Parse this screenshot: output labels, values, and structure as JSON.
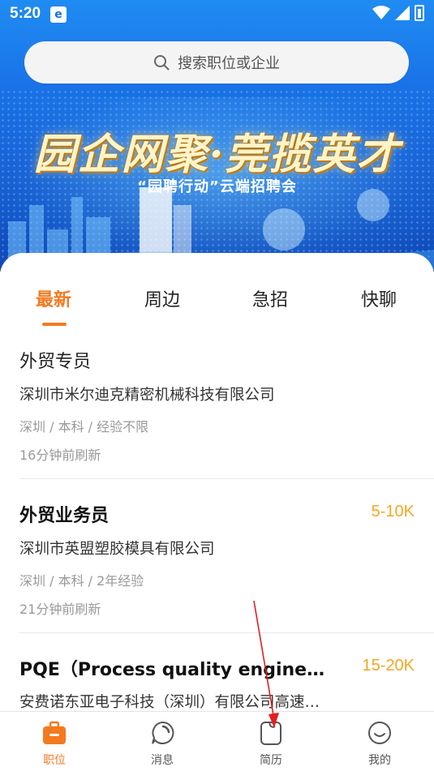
{
  "status_bar": {
    "time": "5:20",
    "app_icon": "browser-icon"
  },
  "search": {
    "placeholder": "搜索职位或企业"
  },
  "banner": {
    "title": "园企网聚·莞揽英才",
    "subtitle": "“园聘行动”云端招聘会"
  },
  "tabs": [
    {
      "label": "最新",
      "active": true
    },
    {
      "label": "周边",
      "active": false
    },
    {
      "label": "急招",
      "active": false
    },
    {
      "label": "快聊",
      "active": false
    }
  ],
  "jobs": [
    {
      "title": "外贸专员",
      "salary": "",
      "company": "深圳市米尔迪克精密机械科技有限公司",
      "meta": "深圳 / 本科 / 经验不限",
      "time": "16分钟前刷新"
    },
    {
      "title": "外贸业务员",
      "salary": "5-10K",
      "company": "深圳市英盟塑胶模具有限公司",
      "meta": "深圳 / 本科 / 2年经验",
      "time": "21分钟前刷新"
    },
    {
      "title": "PQE（Process quality engine…",
      "salary": "15-20K",
      "company": "安费诺东亚电子科技（深圳）有限公司高速…",
      "meta": "",
      "time": ""
    }
  ],
  "bottom_nav": [
    {
      "label": "职位",
      "icon": "briefcase-icon",
      "active": true
    },
    {
      "label": "消息",
      "icon": "chat-icon",
      "active": false
    },
    {
      "label": "简历",
      "icon": "resume-icon",
      "active": false
    },
    {
      "label": "我的",
      "icon": "profile-icon",
      "active": false
    }
  ],
  "colors": {
    "accent": "#f47a1f",
    "salary": "#f5a623",
    "hero_blue": "#1870e6",
    "annotation_arrow": "#e02020"
  }
}
